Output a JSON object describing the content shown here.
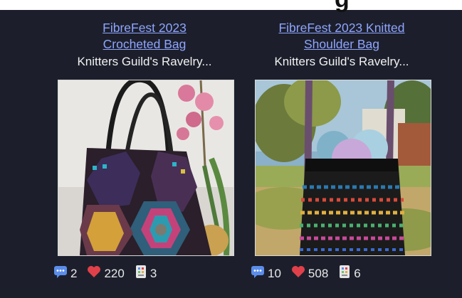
{
  "cards": [
    {
      "title_line1": "FibreFest 2023",
      "title_line2": "Crocheted Bag",
      "owner": "Knitters Guild's Ravelry...",
      "comments": "2",
      "favorites": "220",
      "queued": "3"
    },
    {
      "title_line1": "FibreFest 2023 Knitted",
      "title_line2": "Shoulder Bag",
      "owner": "Knitters Guild's Ravelry...",
      "comments": "10",
      "favorites": "508",
      "queued": "6"
    }
  ],
  "icons": {
    "comments": "comment-bubble-icon",
    "favorites": "heart-icon",
    "queued": "queue-card-icon"
  },
  "colors": {
    "background": "#1c1f2b",
    "link": "#8fa5ff",
    "heart": "#e0404a",
    "comment": "#5b8dea"
  }
}
